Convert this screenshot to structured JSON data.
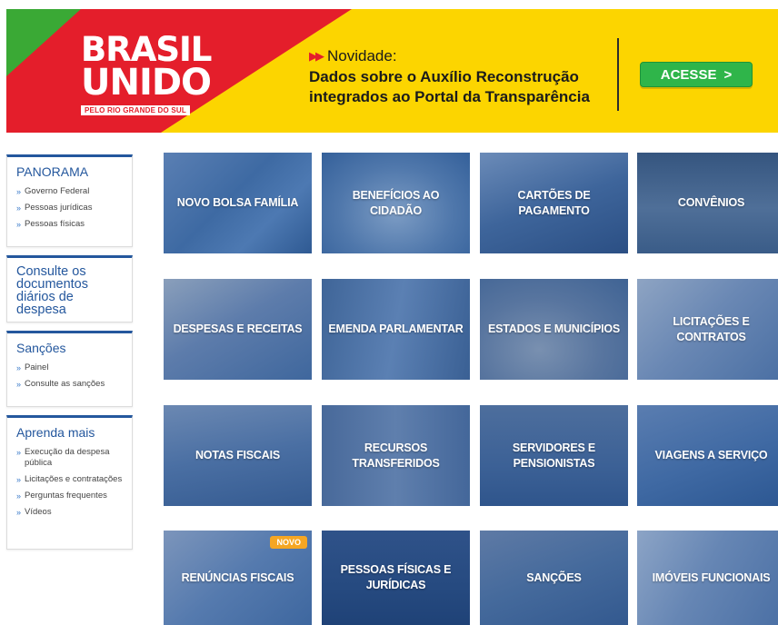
{
  "banner": {
    "logo_line1": "BRASIL",
    "logo_line2": "UNIDO",
    "logo_line3": "PELO RIO GRANDE DO SUL",
    "novidade": "Novidade:",
    "message_line1": "Dados sobre o Auxílio Reconstrução",
    "message_line2": "integrados ao Portal da Transparência",
    "cta": "ACESSE",
    "cta_arrow": ">"
  },
  "sidebar": {
    "panorama": {
      "title": "PANORAMA",
      "items": [
        "Governo Federal",
        "Pessoas jurídicas",
        "Pessoas físicas"
      ]
    },
    "consulte": {
      "title": "Consulte os documentos diários de despesa"
    },
    "sancoes": {
      "title": "Sanções",
      "items": [
        "Painel",
        "Consulte as sanções"
      ]
    },
    "aprenda": {
      "title": "Aprenda mais",
      "items": [
        "Execução da despesa pública",
        "Licitações e contratações",
        "Perguntas frequentes",
        "Vídeos"
      ]
    }
  },
  "tiles": [
    {
      "label": "NOVO BOLSA FAMÍLIA"
    },
    {
      "label": "BENEFÍCIOS AO CIDADÃO"
    },
    {
      "label": "CARTÕES DE PAGAMENTO"
    },
    {
      "label": "CONVÊNIOS"
    },
    {
      "label": "DESPESAS E RECEITAS"
    },
    {
      "label": "EMENDA PARLAMENTAR"
    },
    {
      "label": "ESTADOS E MUNICÍPIOS"
    },
    {
      "label": "LICITAÇÕES E CONTRATOS"
    },
    {
      "label": "NOTAS FISCAIS"
    },
    {
      "label": "RECURSOS TRANSFERIDOS"
    },
    {
      "label": "SERVIDORES E PENSIONISTAS"
    },
    {
      "label": "VIAGENS A SERVIÇO"
    },
    {
      "label": "RENÚNCIAS FISCAIS",
      "badge": "NOVO"
    },
    {
      "label": "PESSOAS FÍSICAS E JURÍDICAS"
    },
    {
      "label": "SANÇÕES"
    },
    {
      "label": "IMÓVEIS FUNCIONAIS"
    }
  ],
  "colors": {
    "brand_blue": "#24579d",
    "banner_yellow": "#fcd500",
    "banner_red": "#e41e2b",
    "banner_green": "#3aa935",
    "cta_green": "#2fb54a",
    "badge_orange": "#f5a623"
  }
}
